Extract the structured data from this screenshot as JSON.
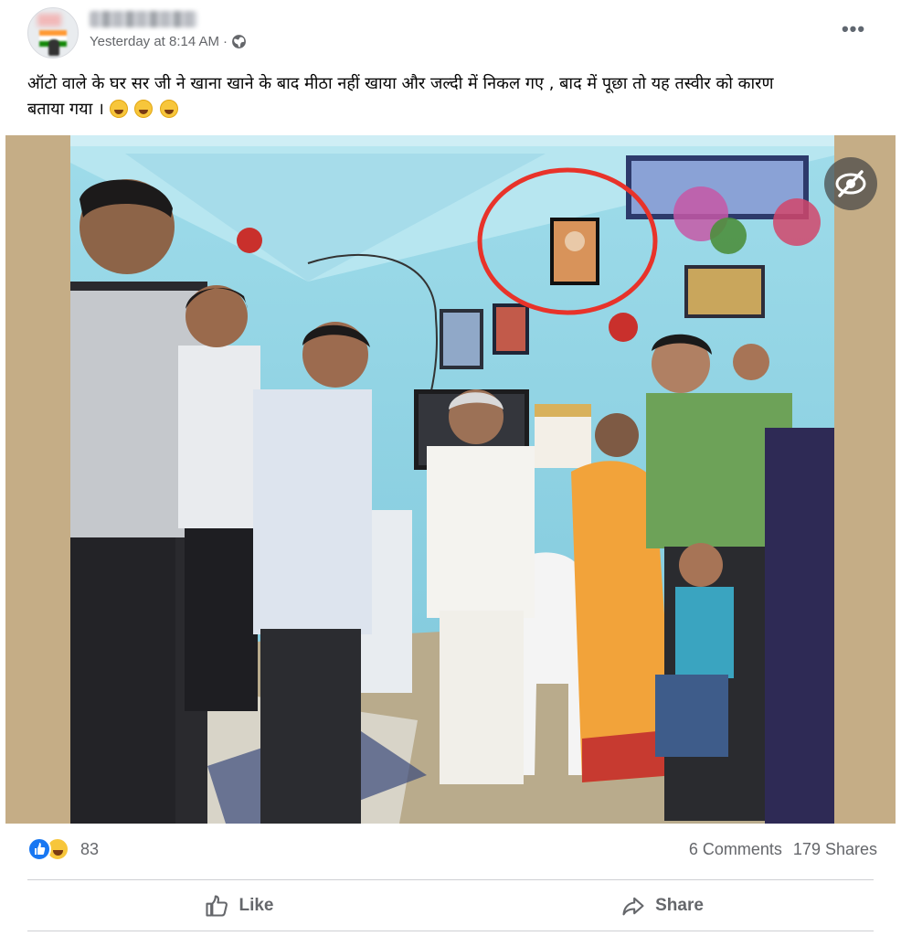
{
  "post": {
    "timestamp": "Yesterday at 8:14 AM",
    "separator": "·",
    "privacy_icon": "globe-icon",
    "more_icon": "more-options-icon",
    "more_label": "•••",
    "caption_line1": "ऑटो वाले के घर सर जी ने खाना खाने के बाद मीठा नहीं खाया और जल्दी में निकल गए , बाद में पूछा तो यह तस्वीर को कारण",
    "caption_line2": "बताया गया ।",
    "caption_emojis": [
      "rolling-on-floor-laughing-emoji",
      "rolling-on-floor-laughing-emoji",
      "rolling-on-floor-laughing-emoji"
    ]
  },
  "photo": {
    "hide_icon": "eye-slash-icon"
  },
  "footer": {
    "reaction_icons": [
      "like-reaction-icon",
      "haha-reaction-icon"
    ],
    "reaction_count": "83",
    "comments": "6 Comments",
    "shares": "179 Shares",
    "like_label": "Like",
    "share_label": "Share"
  },
  "colors": {
    "facebook_blue": "#1877f2",
    "secondary_text": "#65676b",
    "annotation_circle": "#e8332a"
  }
}
